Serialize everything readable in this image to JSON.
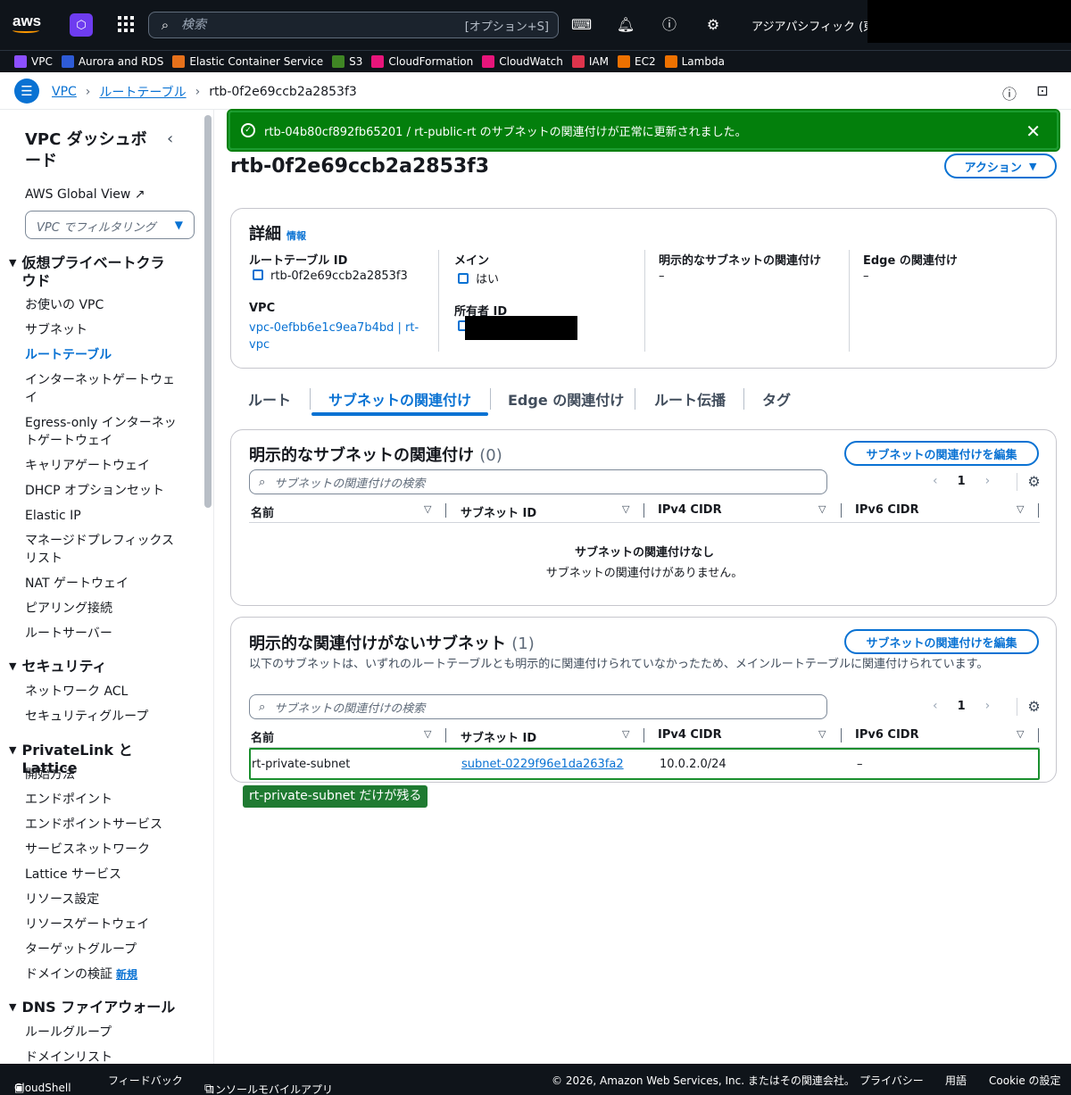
{
  "topbar": {
    "logo": "aws",
    "search_placeholder": "検索",
    "search_shortcut": "[オプション+S]",
    "region": "アジアパシフィック (東京)",
    "icons": [
      "grid-icon",
      "terminal-icon",
      "bell-icon",
      "help-icon",
      "gear-icon"
    ]
  },
  "favorites": [
    {
      "label": "VPC",
      "color": "#8c4fff"
    },
    {
      "label": "Aurora and RDS",
      "color": "#2e5bd6"
    },
    {
      "label": "Elastic Container Service",
      "color": "#e6711b"
    },
    {
      "label": "S3",
      "color": "#3f8624"
    },
    {
      "label": "CloudFormation",
      "color": "#e7157b"
    },
    {
      "label": "CloudWatch",
      "color": "#e7157b"
    },
    {
      "label": "IAM",
      "color": "#dd344c"
    },
    {
      "label": "EC2",
      "color": "#ed7100"
    },
    {
      "label": "Lambda",
      "color": "#ed7100"
    }
  ],
  "breadcrumb": {
    "items": [
      "VPC",
      "ルートテーブル"
    ],
    "current": "rtb-0f2e69ccb2a2853f3"
  },
  "sidebar": {
    "title": "VPC ダッシュボード",
    "global_view": "AWS Global View",
    "filter_placeholder": "VPC でフィルタリング",
    "groups": {
      "vpc": "仮想プライベートクラウド",
      "security": "セキュリティ",
      "privatelink": "PrivateLink と Lattice",
      "dns": "DNS ファイアウォール"
    },
    "vpc_items": [
      "お使いの VPC",
      "サブネット",
      "ルートテーブル",
      "インターネットゲートウェイ",
      "Egress-only インターネットゲートウェイ",
      "キャリアゲートウェイ",
      "DHCP オプションセット",
      "Elastic IP",
      "マネージドプレフィックスリスト",
      "NAT ゲートウェイ",
      "ピアリング接続",
      "ルートサーバー"
    ],
    "security_items": [
      "ネットワーク ACL",
      "セキュリティグループ"
    ],
    "privatelink_items": [
      "開始方法",
      "エンドポイント",
      "エンドポイントサービス",
      "サービスネットワーク",
      "Lattice サービス",
      "リソース設定",
      "リソースゲートウェイ",
      "ターゲットグループ",
      "ドメインの検証"
    ],
    "new_badge": "新規",
    "dns_items": [
      "ルールグループ",
      "ドメインリスト"
    ]
  },
  "flash": {
    "message": "rtb-04b80cf892fb65201 / rt-public-rt のサブネットの関連付けが正常に更新されました。"
  },
  "page": {
    "title": "rtb-0f2e69ccb2a2853f3",
    "action_label": "アクション"
  },
  "details": {
    "heading": "詳細",
    "info": "情報",
    "route_table_id_label": "ルートテーブル ID",
    "route_table_id": "rtb-0f2e69ccb2a2853f3",
    "main_label": "メイン",
    "main_value": "はい",
    "explicit_label": "明示的なサブネットの関連付け",
    "explicit_value": "–",
    "edge_label": "Edge の関連付け",
    "edge_value": "–",
    "vpc_label": "VPC",
    "vpc_value_1": "vpc-0efbb6e1c9ea7b4bd | rt-",
    "vpc_value_2": "vpc",
    "owner_label": "所有者 ID"
  },
  "tabs": [
    "ルート",
    "サブネットの関連付け",
    "Edge の関連付け",
    "ルート伝播",
    "タグ"
  ],
  "explicit_section": {
    "heading": "明示的なサブネットの関連付け",
    "count": "(0)",
    "edit_label": "サブネットの関連付けを編集",
    "search_placeholder": "サブネットの関連付けの検索",
    "page": "1",
    "columns": [
      "名前",
      "サブネット ID",
      "IPv4 CIDR",
      "IPv6 CIDR"
    ],
    "empty_title": "サブネットの関連付けなし",
    "empty_desc": "サブネットの関連付けがありません。"
  },
  "implicit_section": {
    "heading": "明示的な関連付けがないサブネット",
    "count": "(1)",
    "edit_label": "サブネットの関連付けを編集",
    "desc": "以下のサブネットは、いずれのルートテーブルとも明示的に関連付けられていなかったため、メインルートテーブルに関連付けられています。",
    "search_placeholder": "サブネットの関連付けの検索",
    "page": "1",
    "columns": [
      "名前",
      "サブネット ID",
      "IPv4 CIDR",
      "IPv6 CIDR"
    ],
    "row": {
      "name": "rt-private-subnet",
      "subnet_id": "subnet-0229f96e1da263fa2",
      "ipv4": "10.0.2.0/24",
      "ipv6": "–"
    },
    "annotation": "rt-private-subnet だけが残る"
  },
  "footer": {
    "cloudshell": "CloudShell",
    "feedback": "フィードバック",
    "mobile": "コンソールモバイルアプリ",
    "copyright": "© 2026, Amazon Web Services, Inc. またはその関連会社。",
    "privacy": "プライバシー",
    "terms": "用語",
    "cookie": "Cookie の設定"
  }
}
